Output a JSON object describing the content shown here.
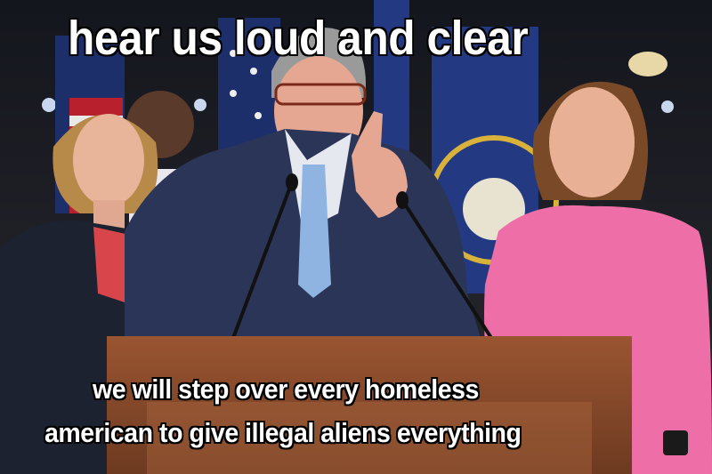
{
  "meme": {
    "top_text": "hear us loud and clear",
    "bottom_text_line1": "we will step over every homeless",
    "bottom_text_line2": "american to give illegal aliens everything"
  },
  "colors": {
    "background": "#1b1d24",
    "caption_text": "#ffffff",
    "caption_outline": "#000000",
    "podium": "#8a4a2b",
    "suit": "#2a3558",
    "pink_dress": "#ee6fa8"
  }
}
